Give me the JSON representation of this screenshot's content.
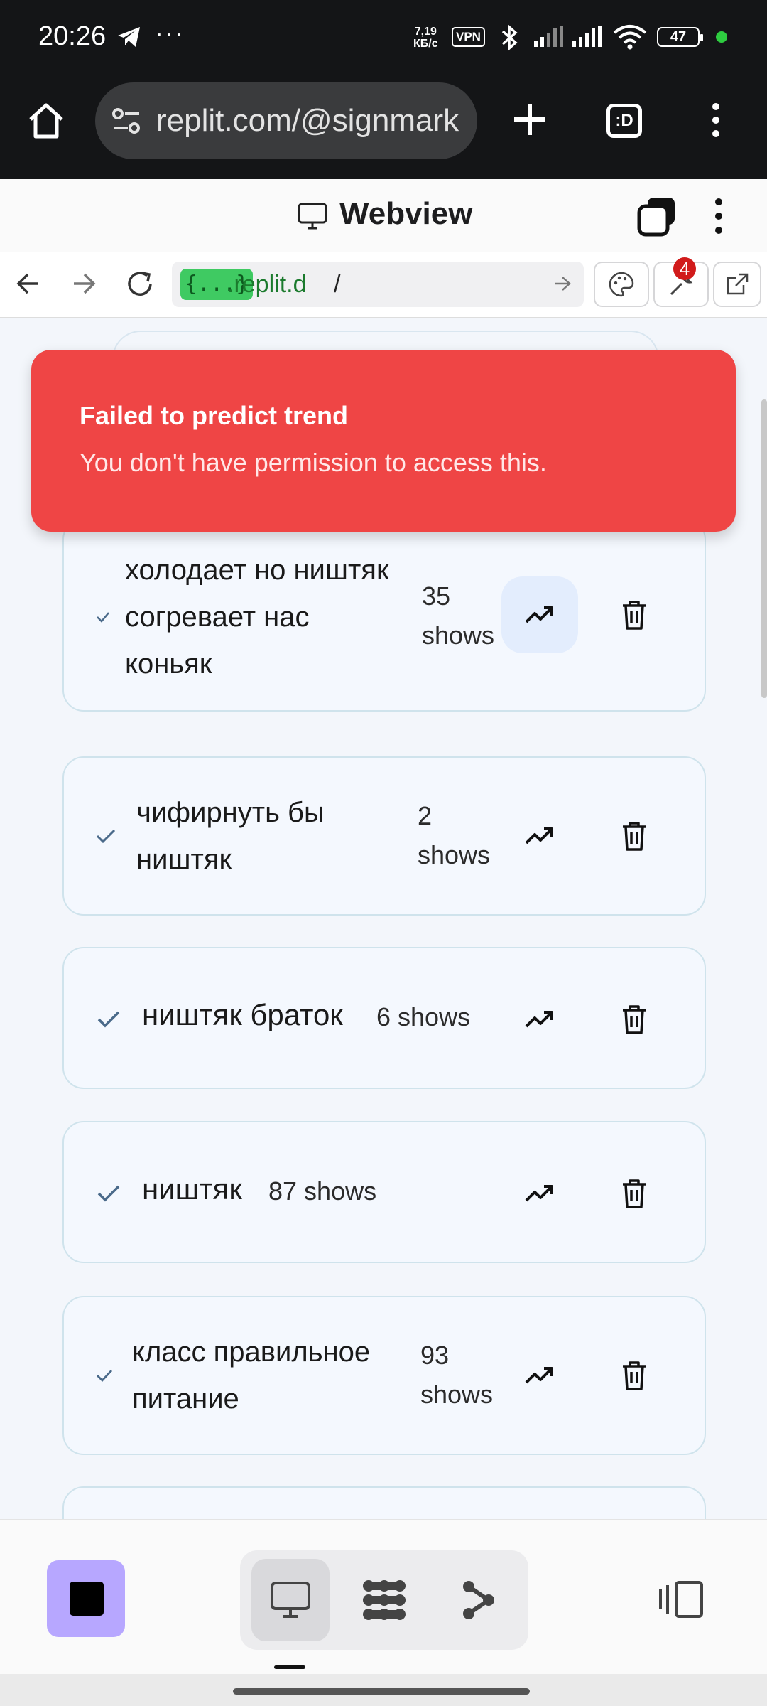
{
  "status_bar": {
    "time": "20:26",
    "dots": "···",
    "speed_top": "7,19",
    "speed_unit": "КБ/с",
    "vpn": "VPN",
    "battery": "47"
  },
  "browser": {
    "url": "replit.com/@signmark"
  },
  "webview": {
    "title": "Webview",
    "address_pill": "{...}",
    "address_host": ".replit.d",
    "address_path": "/",
    "badge_count": "4"
  },
  "toast": {
    "title": "Failed to predict trend",
    "message": "You don't have permission to access this."
  },
  "phrases": [
    {
      "text": "холодает но ништяк согревает нас коньяк",
      "shows": "35 shows"
    },
    {
      "text": "чифирнуть бы ништяк",
      "shows": "2 shows"
    },
    {
      "text": "ништяк браток",
      "shows": "6 shows"
    },
    {
      "text": "ништяк",
      "shows": "87 shows"
    },
    {
      "text": "класс правильное питание",
      "shows": "93 shows"
    }
  ],
  "colors": {
    "toast_bg": "#ef4545",
    "stop_button": "#b7a7ff",
    "trend_active_bg": "#e3edfd"
  }
}
